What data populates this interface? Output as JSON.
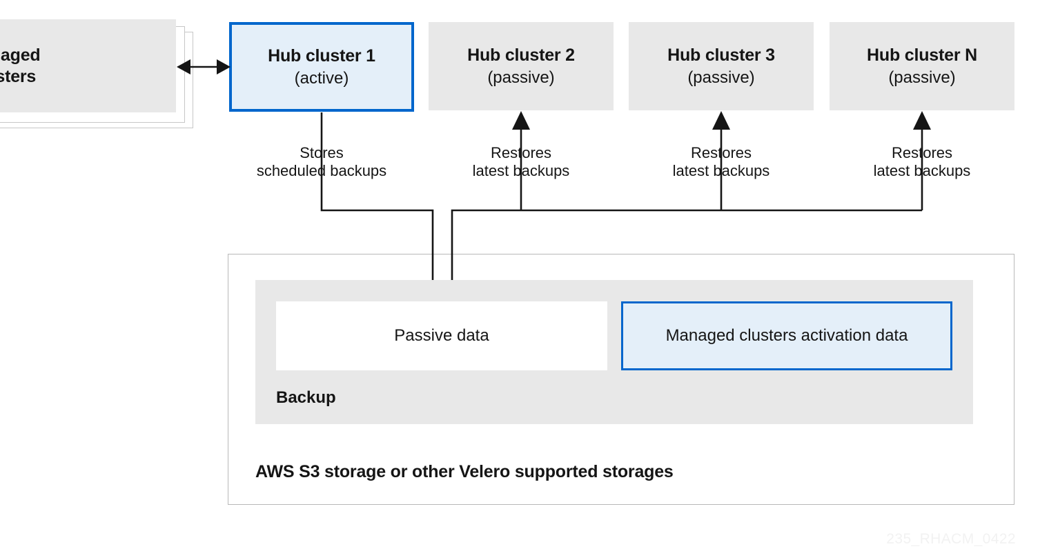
{
  "diagram": {
    "watermark": "235_RHACM_0422",
    "colors": {
      "accent_blue": "#0066CC",
      "highlight_fill": "#E4EFF9",
      "box_gray": "#E8E8E8",
      "border_gray": "#B8B8B8",
      "text": "#151515",
      "watermark": "#F2F2F2"
    }
  },
  "clusters": {
    "managed": {
      "title": "Managed",
      "subtitle": "clusters"
    },
    "hubs": [
      {
        "title": "Hub cluster 1",
        "state": "(active)",
        "active": true
      },
      {
        "title": "Hub cluster 2",
        "state": "(passive)",
        "active": false
      },
      {
        "title": "Hub cluster 3",
        "state": "(passive)",
        "active": false
      },
      {
        "title": "Hub cluster N",
        "state": "(passive)",
        "active": false
      }
    ]
  },
  "edges": [
    {
      "line1": "Stores",
      "line2": "scheduled backups"
    },
    {
      "line1": "Restores",
      "line2": "latest backups"
    },
    {
      "line1": "Restores",
      "line2": "latest backups"
    },
    {
      "line1": "Restores",
      "line2": "latest backups"
    }
  ],
  "storage": {
    "caption": "AWS S3 storage or other Velero supported storages",
    "backup": {
      "caption": "Backup",
      "data_boxes": [
        {
          "label": "Passive data",
          "highlight": false
        },
        {
          "label": "Managed clusters activation data",
          "highlight": true
        }
      ]
    }
  }
}
